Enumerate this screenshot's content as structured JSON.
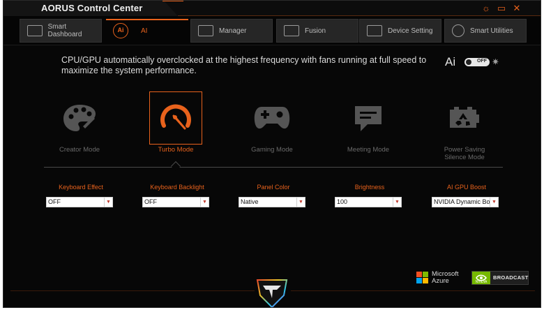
{
  "window": {
    "title": "AORUS Control Center"
  },
  "nav": {
    "tabs": [
      {
        "label": "Smart Dashboard",
        "icon": "dashboard-icon"
      },
      {
        "label": "AI",
        "icon": "ai-icon",
        "active": true,
        "icon_text": "Ai"
      },
      {
        "label": "Manager",
        "icon": "keyboard-manager-icon"
      },
      {
        "label": "Fusion",
        "icon": "keyboard-fusion-icon"
      },
      {
        "label": "Device Setting",
        "icon": "laptop-icon"
      },
      {
        "label": "Smart Utilities",
        "icon": "utilities-icon"
      }
    ]
  },
  "ai_panel": {
    "description": "CPU/GPU automatically overclocked at the highest frequency with fans running at full speed to maximize the system performance.",
    "logo_text": "Ai",
    "toggle_label": "OFF",
    "accent": "#e8621c"
  },
  "modes": [
    {
      "label": "Creator Mode",
      "icon": "palette-icon"
    },
    {
      "label": "Turbo Mode",
      "icon": "speedometer-icon",
      "active": true
    },
    {
      "label": "Gaming Mode",
      "icon": "gamepad-icon"
    },
    {
      "label": "Meeting Mode",
      "icon": "chat-icon"
    },
    {
      "label": "Power Saving\nSilence Mode",
      "icon": "battery-recycle-icon"
    }
  ],
  "settings": [
    {
      "label": "Keyboard Effect",
      "value": "OFF"
    },
    {
      "label": "Keyboard Backlight",
      "value": "OFF"
    },
    {
      "label": "Panel Color",
      "value": "Native"
    },
    {
      "label": "Brightness",
      "value": "100"
    },
    {
      "label": "AI GPU Boost",
      "value": "NVIDIA Dynamic Boost"
    }
  ],
  "partners": {
    "microsoft_line1": "Microsoft",
    "microsoft_line2": "Azure",
    "nvidia_logo_text": "NVIDIA",
    "nvidia_text": "BROADCAST"
  }
}
